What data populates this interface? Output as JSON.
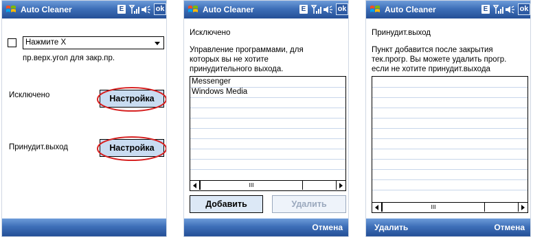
{
  "screens": [
    {
      "title": "Auto Cleaner",
      "status": {
        "e_label": "E",
        "ok_label": "ok"
      },
      "combo_value": "Нажмите X",
      "combo_hint": "пр.верх.угол для закр.пр.",
      "excluded_label": "Исключено",
      "excluded_button": "Настройка",
      "forced_label": "Принудит.выход",
      "forced_button": "Настройка"
    },
    {
      "title": "Auto Cleaner",
      "status": {
        "e_label": "E",
        "ok_label": "ok"
      },
      "heading": "Исключено",
      "desc_lines": [
        "Управление программами, для",
        "которых вы не хотите",
        "принудительного выхода."
      ],
      "list_items": [
        "Messenger",
        "Windows Media"
      ],
      "scroll_thumb_label": "III",
      "add_button": "Добавить",
      "delete_button": "Удалить",
      "softkey_right": "Отмена"
    },
    {
      "title": "Auto Cleaner",
      "status": {
        "e_label": "E",
        "ok_label": "ok"
      },
      "heading": "Принудит.выход",
      "desc_lines": [
        "Пункт добавится после закрытия",
        "тек.прогр. Вы можете удалить прогр.",
        "если не хотите принудит.выхода"
      ],
      "scroll_thumb_label": "III",
      "softkey_left": "Удалить",
      "softkey_right": "Отмена"
    }
  ],
  "colors": {
    "titlebar": "#3e6fb8",
    "highlight_oval": "#d62020",
    "button_fill": "#c9dcf1"
  }
}
